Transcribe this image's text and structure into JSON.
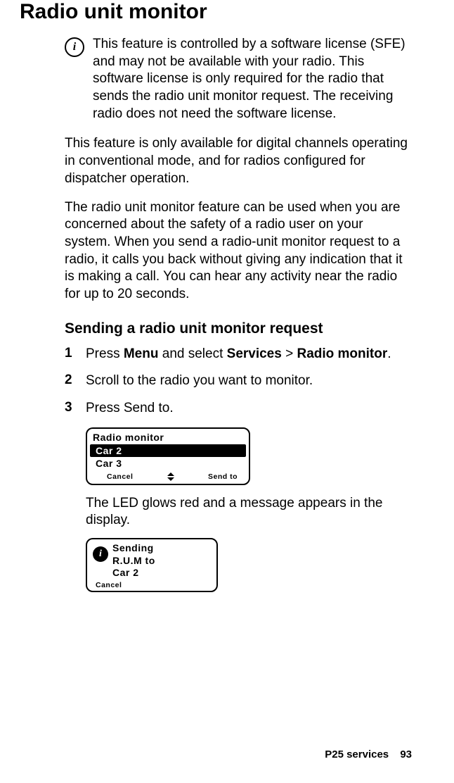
{
  "title": "Radio unit monitor",
  "info_icon_glyph": "i",
  "license_note": "This feature is controlled by a software license (SFE) and may not be available with your radio. This software license is only required for the radio that sends the radio unit monitor request. The receiving radio does not need the software license.",
  "para_availability": "This feature is only available for digital channels operating in conventional mode, and for radios configured for dispatcher operation.",
  "para_description": "The radio unit monitor feature can be used when you are concerned about the safety of a radio user on your system. When you send a radio-unit monitor request to a radio, it calls you back without giving any indication that it is making a call. You can hear any activity near the radio for up to 20 seconds.",
  "subheading": "Sending a radio unit monitor request",
  "steps": {
    "s1": {
      "num": "1",
      "pre": "Press ",
      "b1": "Menu",
      "mid1": " and select ",
      "b2": "Services",
      "mid2": " > ",
      "b3": "Radio monitor",
      "post": "."
    },
    "s2": {
      "num": "2",
      "text": "Scroll to the radio you want to monitor."
    },
    "s3": {
      "num": "3",
      "text": "Press Send to."
    }
  },
  "lcd1": {
    "title": "Radio monitor",
    "row_selected": "Car 2",
    "row_other": "Car 3",
    "soft_left": "Cancel",
    "soft_right": "Send to"
  },
  "after_lcd1": "The LED glows red and a message appears in the display.",
  "lcd2": {
    "icon_glyph": "i",
    "line1": "Sending",
    "line2": "R.U.M to",
    "line3": "Car 2",
    "soft_left": "Cancel"
  },
  "footer": {
    "section": "P25 services",
    "page": "93"
  }
}
